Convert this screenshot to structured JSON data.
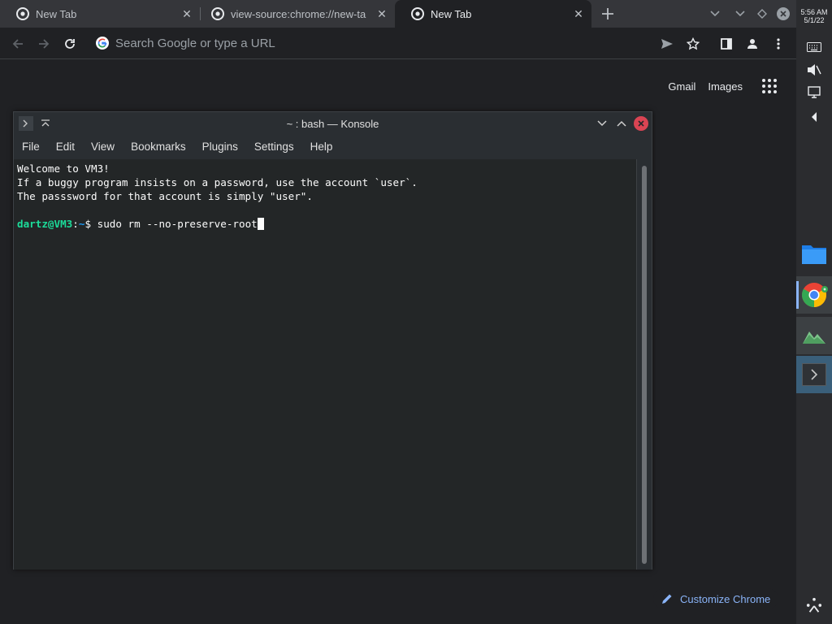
{
  "tabs": [
    {
      "title": "New Tab",
      "active": false
    },
    {
      "title": "view-source:chrome://new-ta",
      "active": false
    },
    {
      "title": "New Tab",
      "active": true
    }
  ],
  "omnibox": {
    "placeholder": "Search Google or type a URL",
    "value": ""
  },
  "ntp": {
    "gmail": "Gmail",
    "images": "Images",
    "customize": "Customize Chrome"
  },
  "konsole": {
    "title": "~ : bash — Konsole",
    "menu": [
      "File",
      "Edit",
      "View",
      "Bookmarks",
      "Plugins",
      "Settings",
      "Help"
    ],
    "output": [
      "Welcome to VM3!",
      "If a buggy program insists on a password, use the account `user`.",
      "The passsword for that account is simply \"user\".",
      ""
    ],
    "prompt": {
      "user_host": "dartz@VM3",
      "sep": ":",
      "path": "~",
      "symbol": "$",
      "command": "sudo rm --no-preserve-root"
    }
  },
  "shelf": {
    "time": "5:56 AM",
    "date": "5/1/22",
    "apps": [
      "files-app",
      "chrome-app",
      "gallery-app",
      "terminal-app"
    ]
  },
  "colors": {
    "accent": "#8ab4f8",
    "prompt_user": "#1cdc9a",
    "prompt_path": "#1d99f3",
    "close_red": "#da4453"
  }
}
